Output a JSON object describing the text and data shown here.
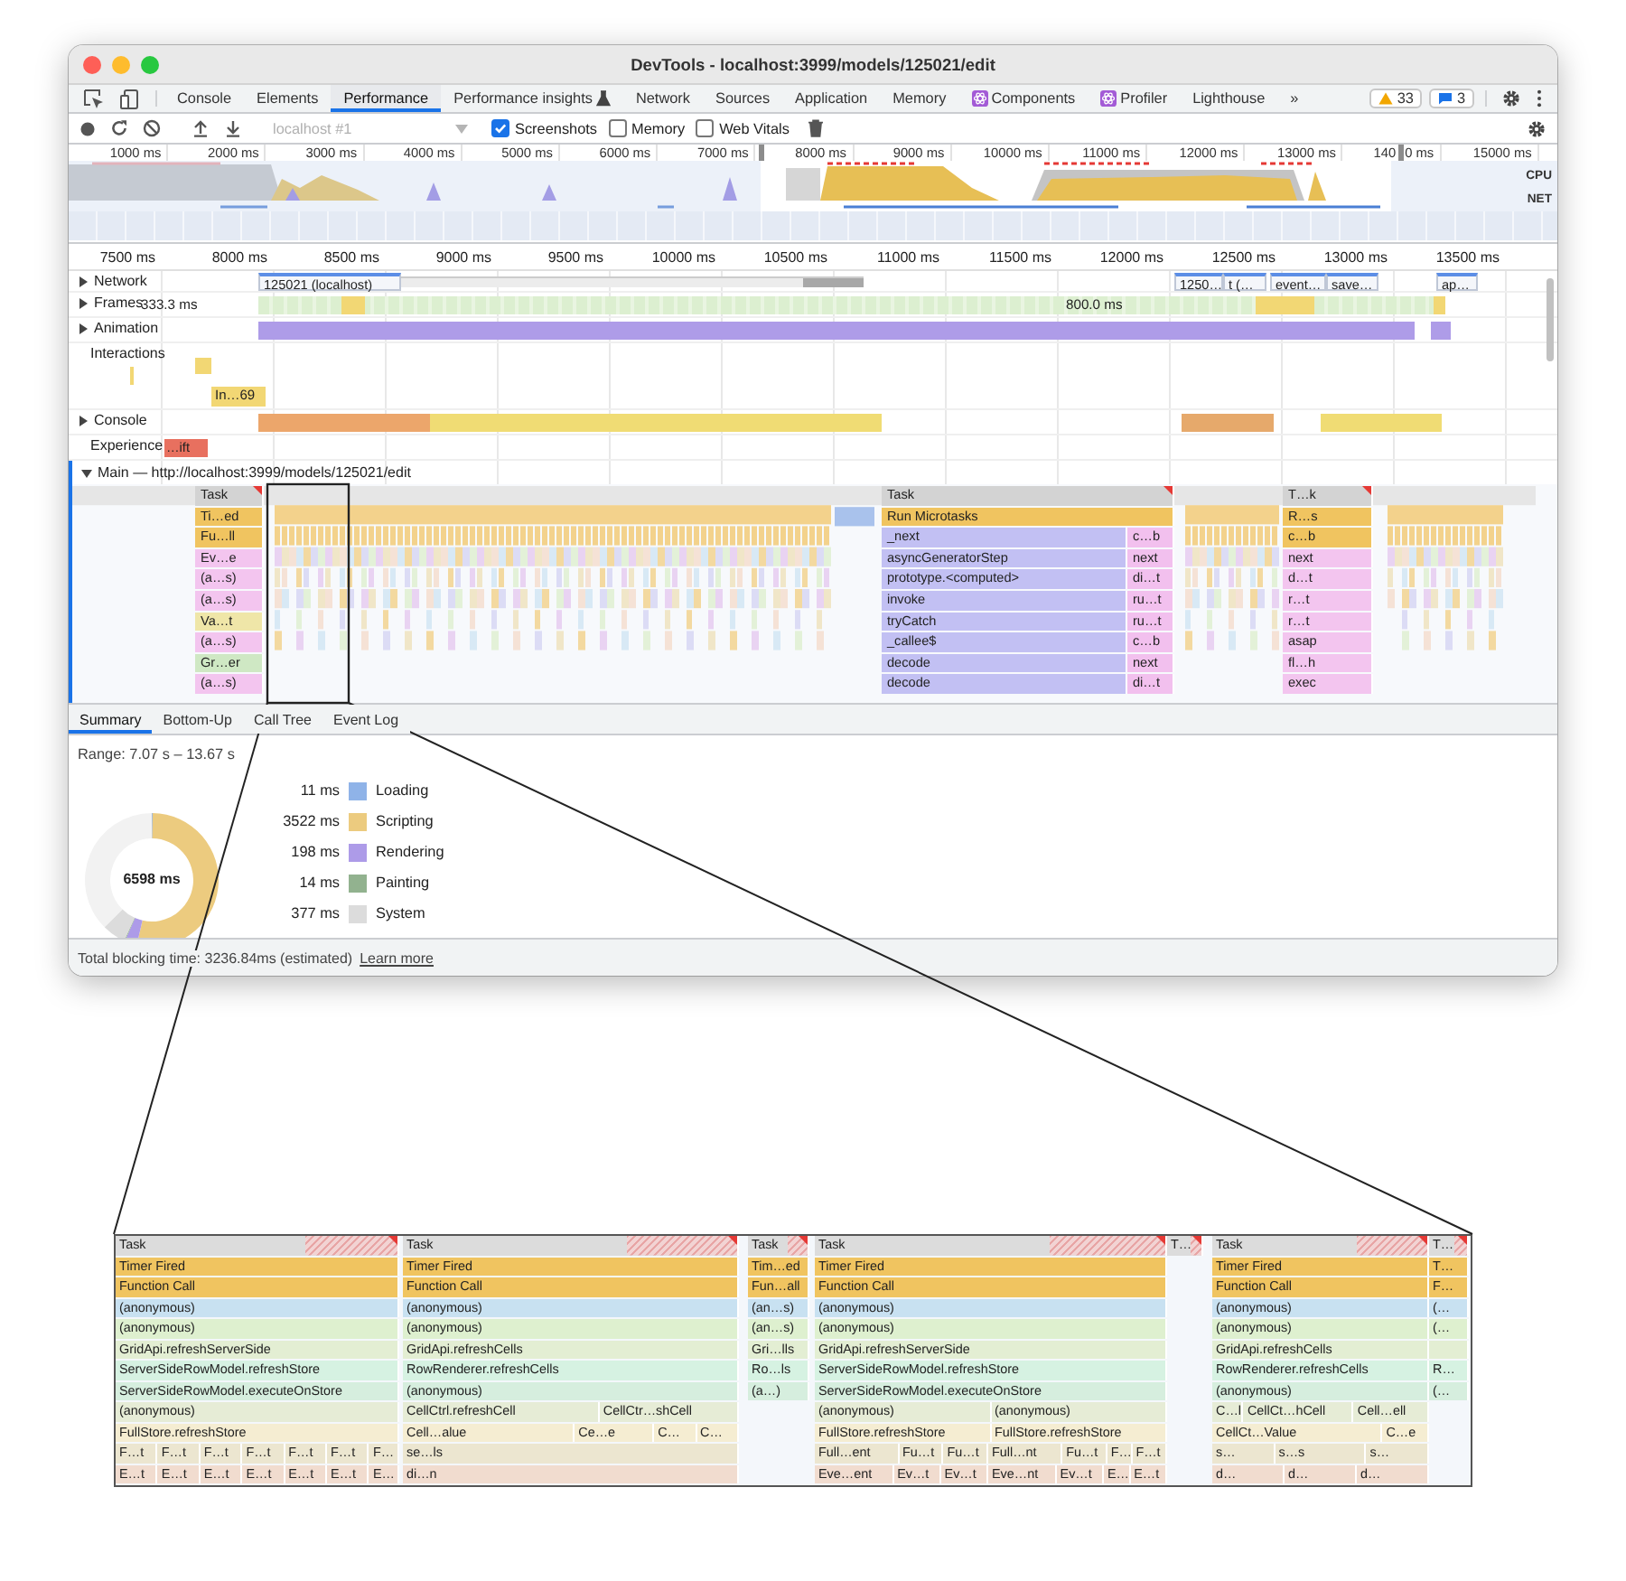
{
  "window": {
    "title": "DevTools - localhost:3999/models/125021/edit"
  },
  "tabs": [
    {
      "label": "Console",
      "selected": false
    },
    {
      "label": "Elements",
      "selected": false
    },
    {
      "label": "Performance",
      "selected": true
    },
    {
      "label": "Performance insights",
      "selected": false,
      "kind": "experimental"
    },
    {
      "label": "Network",
      "selected": false
    },
    {
      "label": "Sources",
      "selected": false
    },
    {
      "label": "Application",
      "selected": false
    },
    {
      "label": "Memory",
      "selected": false
    },
    {
      "label": "Components",
      "selected": false,
      "kind": "extension"
    },
    {
      "label": "Profiler",
      "selected": false,
      "kind": "extension"
    },
    {
      "label": "Lighthouse",
      "selected": false
    }
  ],
  "more_tabs": "»",
  "badges": [
    {
      "kind": "warning",
      "count": "33"
    },
    {
      "kind": "message",
      "count": "3"
    }
  ],
  "toolbar": {
    "target": {
      "value": "localhost #1",
      "disabled": true
    },
    "checkboxes": [
      {
        "label": "Screenshots",
        "checked": true
      },
      {
        "label": "Memory",
        "checked": false
      },
      {
        "label": "Web Vitals",
        "checked": false
      }
    ]
  },
  "overview": {
    "ticks": [
      {
        "label": "1000 ms"
      },
      {
        "label": "2000 ms"
      },
      {
        "label": "3000 ms"
      },
      {
        "label": "4000 ms"
      },
      {
        "label": "5000 ms"
      },
      {
        "label": "6000 ms"
      },
      {
        "label": "7000 ms"
      },
      {
        "label": "8000 ms"
      },
      {
        "label": "9000 ms"
      },
      {
        "label": "10000 ms"
      },
      {
        "label": "11000 ms"
      },
      {
        "label": "12000 ms"
      },
      {
        "label": "13000 ms"
      },
      {
        "label": "140",
        "after_handle": "0 ms"
      },
      {
        "label": "15000 ms"
      }
    ],
    "lanes": [
      "CPU",
      "NET"
    ]
  },
  "ruler": [
    "7500 ms",
    "8000 ms",
    "8500 ms",
    "9000 ms",
    "9500 ms",
    "10000 ms",
    "10500 ms",
    "11000 ms",
    "11500 ms",
    "12000 ms",
    "12500 ms",
    "13000 ms",
    "13500 ms"
  ],
  "tracks": [
    {
      "kind": "network",
      "label": "Network",
      "expanded": false,
      "bars": [
        "125021 (localhost)",
        "1250…",
        "t (…",
        "event…",
        "save…",
        "ap…"
      ]
    },
    {
      "kind": "frames",
      "label": "Frames",
      "expanded": false,
      "bars": [
        "333.3 ms",
        "800.0 ms"
      ]
    },
    {
      "kind": "animation",
      "label": "Animation",
      "expanded": false
    },
    {
      "kind": "interactions",
      "label": "Interactions",
      "bars": [
        "In…69"
      ]
    },
    {
      "kind": "console",
      "label": "Console",
      "expanded": false
    },
    {
      "kind": "experience",
      "label": "Experience",
      "bars": [
        "…ift"
      ]
    }
  ],
  "main": {
    "label": "Main — http://localhost:3999/models/125021/edit",
    "expanded": true,
    "stacks": [
      {
        "rows": [
          [
            "Task"
          ],
          [
            "Ti…ed"
          ],
          [
            "Fu…ll"
          ],
          [
            "Ev…e"
          ],
          [
            "(a…s)"
          ],
          [
            "(a…s)"
          ],
          [
            "Va…t"
          ],
          [
            "(a…s)"
          ],
          [
            "Gr…er"
          ],
          [
            "(a…s)"
          ]
        ]
      },
      {
        "rows": [
          [
            "Task"
          ],
          [
            "Run Microtasks"
          ],
          [
            "_next",
            "c…b"
          ],
          [
            "asyncGeneratorStep",
            "next"
          ],
          [
            "prototype.<computed>",
            "di…t"
          ],
          [
            "invoke",
            "ru…t"
          ],
          [
            "tryCatch",
            "ru…t"
          ],
          [
            "_callee$",
            "c…b"
          ],
          [
            "decode",
            "next"
          ],
          [
            "decode",
            "di…t"
          ]
        ]
      },
      {
        "rows": [
          [
            "T…k"
          ],
          [
            "R…s"
          ],
          [
            "c…b"
          ],
          [
            "next"
          ],
          [
            "d…t"
          ],
          [
            "r…t"
          ],
          [
            "r…t"
          ],
          [
            "asap"
          ],
          [
            "fl…h"
          ],
          [
            "exec"
          ]
        ]
      }
    ]
  },
  "details": {
    "tabs": [
      {
        "label": "Summary",
        "selected": true
      },
      {
        "label": "Bottom-Up",
        "selected": false
      },
      {
        "label": "Call Tree",
        "selected": false
      },
      {
        "label": "Event Log",
        "selected": false
      }
    ],
    "range": "Range: 7.07 s – 13.67 s",
    "total": "6598 ms",
    "legend": [
      {
        "value": "11 ms",
        "label": "Loading",
        "color": "#8fb3e8"
      },
      {
        "value": "3522 ms",
        "label": "Scripting",
        "color": "#eccb7f"
      },
      {
        "value": "198 ms",
        "label": "Rendering",
        "color": "#ad9be8"
      },
      {
        "value": "14 ms",
        "label": "Painting",
        "color": "#92b28f"
      },
      {
        "value": "377 ms",
        "label": "System",
        "color": "#dcdcdc"
      }
    ],
    "footer": {
      "text": "Total blocking time: 3236.84ms (estimated)",
      "link": "Learn more"
    }
  },
  "zoom_inset": {
    "segments": [
      {
        "rows": [
          [
            "Task"
          ],
          [
            "Timer Fired"
          ],
          [
            "Function Call"
          ],
          [
            "(anonymous)"
          ],
          [
            "(anonymous)"
          ],
          [
            "GridApi.refreshServerSide"
          ],
          [
            "ServerSideRowModel.refreshStore"
          ],
          [
            "ServerSideRowModel.executeOnStore"
          ],
          [
            "(anonymous)"
          ],
          [
            "FullStore.refreshStore"
          ],
          [
            "F…t",
            "F…t",
            "F…t",
            "F…t",
            "F…t",
            "F…t",
            "F…"
          ],
          [
            "E…t",
            "E…t",
            "E…t",
            "E…t",
            "E…t",
            "E…t",
            "E…"
          ]
        ]
      },
      {
        "rows": [
          [
            "Task"
          ],
          [
            "Timer Fired"
          ],
          [
            "Function Call"
          ],
          [
            "(anonymous)"
          ],
          [
            "(anonymous)"
          ],
          [
            "GridApi.refreshCells"
          ],
          [
            "RowRenderer.refreshCells"
          ],
          [
            "(anonymous)"
          ],
          [
            "CellCtrl.refreshCell",
            "CellCtr…shCell"
          ],
          [
            "Cell…alue",
            "Ce…e",
            "C…",
            "C…"
          ],
          [
            "se…ls"
          ],
          [
            "di…n"
          ]
        ]
      },
      {
        "rows": [
          [
            "Task"
          ],
          [
            "Tim…ed"
          ],
          [
            "Fun…all"
          ],
          [
            "(an…s)"
          ],
          [
            "(an…s)"
          ],
          [
            "Gri…lls"
          ],
          [
            "Ro…ls"
          ],
          [
            "(a…)"
          ]
        ]
      },
      {
        "rows": [
          [
            "Task"
          ],
          [
            "Timer Fired"
          ],
          [
            "Function Call"
          ],
          [
            "(anonymous)"
          ],
          [
            "(anonymous)"
          ],
          [
            "GridApi.refreshServerSide"
          ],
          [
            "ServerSideRowModel.refreshStore"
          ],
          [
            "ServerSideRowModel.executeOnStore"
          ],
          [
            "(anonymous)",
            "(anonymous)"
          ],
          [
            "FullStore.refreshStore",
            "FullStore.refreshStore"
          ],
          [
            "Full…ent",
            "Fu…t",
            "Fu…t",
            "Full…nt",
            "Fu…t",
            "F…",
            "F…t"
          ],
          [
            "Eve…ent",
            "Ev…t",
            "Ev…t",
            "Eve…nt",
            "Ev…t",
            "E…",
            "E…t"
          ]
        ]
      },
      {
        "rows": [
          [
            "T…"
          ]
        ]
      },
      {
        "rows": [
          [
            "Task"
          ],
          [
            "Timer Fired"
          ],
          [
            "Function Call"
          ],
          [
            "(anonymous)"
          ],
          [
            "(anonymous)"
          ],
          [
            "GridApi.refreshCells"
          ],
          [
            "RowRenderer.refreshCells"
          ],
          [
            "(anonymous)"
          ],
          [
            "C…l",
            "CellCt…hCell",
            "Cell…ell"
          ],
          [
            "CellCt…Value",
            "C…e"
          ],
          [
            "s…",
            "s…s",
            "s…"
          ],
          [
            "d…",
            "d…",
            "d…"
          ]
        ]
      },
      {
        "rows": [
          [
            "T…"
          ],
          [
            "T…"
          ],
          [
            "F…"
          ],
          [
            "(…"
          ],
          [
            "(…"
          ],
          [],
          [
            "R…"
          ],
          [
            "(…"
          ]
        ]
      }
    ]
  }
}
